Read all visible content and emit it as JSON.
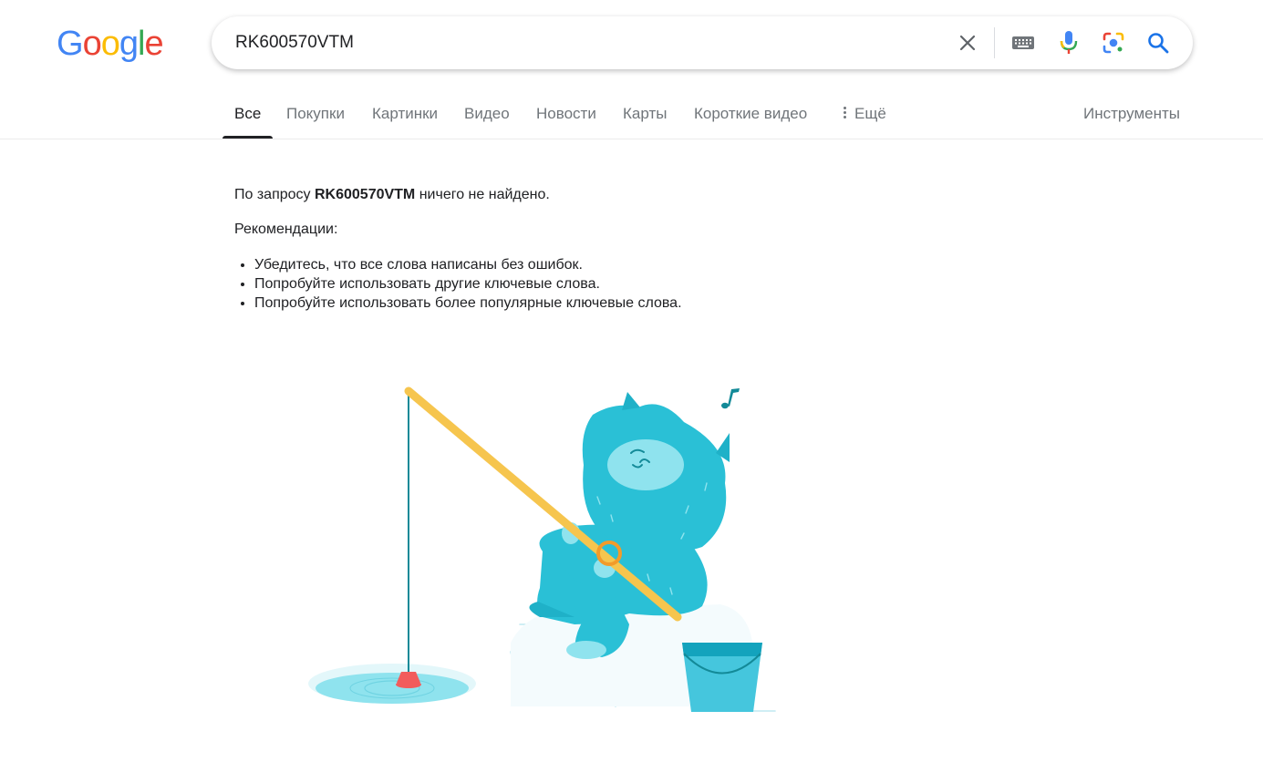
{
  "header": {
    "logo": [
      "G",
      "o",
      "o",
      "g",
      "l",
      "e"
    ],
    "logo_colors": [
      "#4285F4",
      "#EA4335",
      "#FBBC05",
      "#4285F4",
      "#34A853",
      "#EA4335"
    ],
    "search_value": "RK600570VTM",
    "icons": [
      "close-icon",
      "keyboard-icon",
      "mic-icon",
      "lens-icon",
      "search-icon"
    ]
  },
  "tabs": {
    "items": [
      "Все",
      "Покупки",
      "Картинки",
      "Видео",
      "Новости",
      "Карты",
      "Короткие видео"
    ],
    "more_label": "Ещё",
    "tools_label": "Инструменты",
    "active_index": 0
  },
  "results": {
    "no_results_prefix": "По запросу ",
    "no_results_query": "RK600570VTM",
    "no_results_suffix": " ничего не найдено.",
    "recommendations_title": "Рекомендации:",
    "recommendations": [
      "Убедитесь, что все слова написаны без ошибок.",
      "Попробуйте использовать другие ключевые слова.",
      "Попробуйте использовать более популярные ключевые слова."
    ]
  },
  "colors": {
    "accent_blue": "#1a73e8",
    "yeti": "#2ac0d6",
    "yeti_face": "#8fe3ee",
    "rod": "#f6c54e",
    "float": "#f25c5c"
  }
}
